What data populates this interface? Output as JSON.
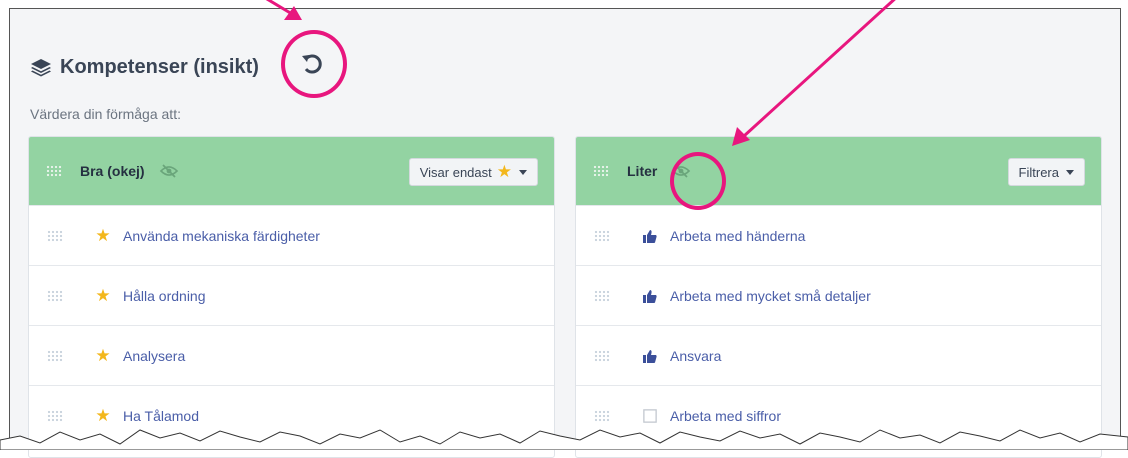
{
  "page": {
    "title": "Kompetenser (insikt)",
    "subtitle": "Värdera din förmåga att:"
  },
  "icons": {
    "title": "layers-icon",
    "reset": "undo-icon",
    "hidden": "eye-slash-icon",
    "grip": "drag-handle-icon",
    "star": "star-icon",
    "thumb": "thumbs-up-icon",
    "empty": "checkbox-icon"
  },
  "panels": [
    {
      "title": "Bra (okej)",
      "dropdown": "Visar endast",
      "dropdown_icon": "star-icon",
      "items": [
        {
          "label": "Använda mekaniska färdigheter",
          "icon": "star"
        },
        {
          "label": "Hålla ordning",
          "icon": "star"
        },
        {
          "label": "Analysera",
          "icon": "star"
        },
        {
          "label": "Ha Tålamod",
          "icon": "star"
        }
      ]
    },
    {
      "title": "Liter",
      "dropdown": "Filtrera",
      "items": [
        {
          "label": "Arbeta med händerna",
          "icon": "thumb"
        },
        {
          "label": "Arbeta med mycket små detaljer",
          "icon": "thumb"
        },
        {
          "label": "Ansvara",
          "icon": "thumb"
        },
        {
          "label": "Arbeta med siffror",
          "icon": "empty"
        }
      ]
    }
  ],
  "colors": {
    "panel_header": "#93d3a2",
    "highlight": "#e8167e",
    "link": "#4a5ea8",
    "star": "#f3b71c",
    "thumb": "#3b4f9a"
  }
}
